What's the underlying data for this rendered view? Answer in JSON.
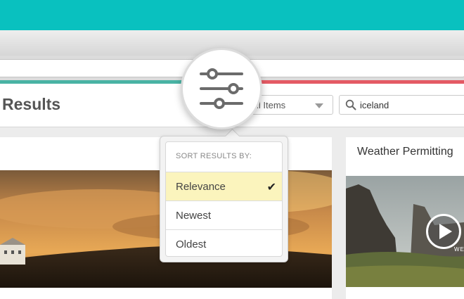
{
  "header": {
    "title": "Results",
    "filter_value": "ll Items",
    "search_value": "iceland"
  },
  "sort_menu": {
    "heading": "SORT RESULTS BY:",
    "options": [
      {
        "label": "Relevance",
        "selected": true
      },
      {
        "label": "Newest",
        "selected": false
      },
      {
        "label": "Oldest",
        "selected": false
      }
    ],
    "check_mark": "✔"
  },
  "cards": {
    "right_title": "Weather Permitting",
    "right_watermark": "WE"
  },
  "icons": {
    "filter_toggle": "sliders-icon",
    "search": "search-icon",
    "dropdown": "caret-down-icon",
    "play": "play-icon"
  },
  "colors": {
    "top_bar": "#09c1bf",
    "accent_left": "#49b3a4",
    "accent_right": "#e45a64",
    "selected_option": "#fbf4bd"
  }
}
